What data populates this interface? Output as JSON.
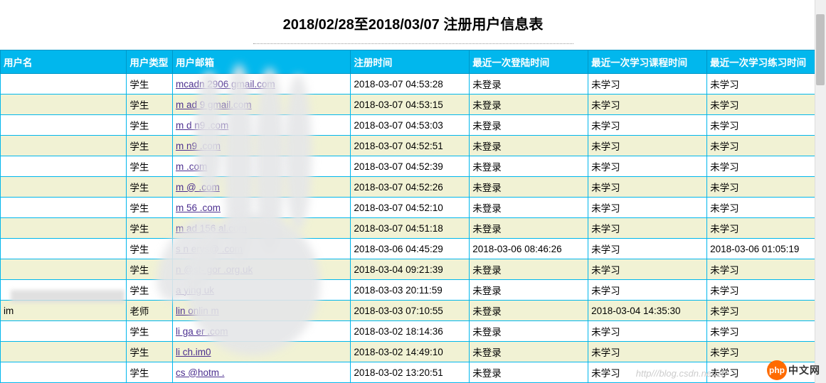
{
  "title": "2018/02/28至2018/03/07 注册用户信息表",
  "columns": {
    "username": "用户名",
    "type": "用户类型",
    "email": "用户邮箱",
    "regtime": "注册时间",
    "lastlogin": "最近一次登陆时间",
    "laststudy": "最近一次学习课程时间",
    "lastpractice": "最近一次学习练习时间"
  },
  "rows": [
    {
      "username": "",
      "type": "学生",
      "email": "mcadn    2906   gmail.com",
      "regtime": "2018-03-07 04:53:28",
      "lastlogin": "未登录",
      "laststudy": "未学习",
      "lastpractice": "未学习"
    },
    {
      "username": "",
      "type": "学生",
      "email": "m   ad       9     gmail.com",
      "regtime": "2018-03-07 04:53:15",
      "lastlogin": "未登录",
      "laststudy": "未学习",
      "lastpractice": "未学习"
    },
    {
      "username": "",
      "type": "学生",
      "email": "m   d    n9          .com",
      "regtime": "2018-03-07 04:53:03",
      "lastlogin": "未登录",
      "laststudy": "未学习",
      "lastpractice": "未学习"
    },
    {
      "username": "",
      "type": "学生",
      "email": "m       n9          .com",
      "regtime": "2018-03-07 04:52:51",
      "lastlogin": "未登录",
      "laststudy": "未学习",
      "lastpractice": "未学习"
    },
    {
      "username": "",
      "type": "学生",
      "email": "m                   .com",
      "regtime": "2018-03-07 04:52:39",
      "lastlogin": "未登录",
      "laststudy": "未学习",
      "lastpractice": "未学习"
    },
    {
      "username": "",
      "type": "学生",
      "email": "m              @    .com",
      "regtime": "2018-03-07 04:52:26",
      "lastlogin": "未登录",
      "laststudy": "未学习",
      "lastpractice": "未学习"
    },
    {
      "username": "",
      "type": "学生",
      "email": "m          56      .com",
      "regtime": "2018-03-07 04:52:10",
      "lastlogin": "未登录",
      "laststudy": "未学习",
      "lastpractice": "未学习"
    },
    {
      "username": "",
      "type": "学生",
      "email": "m   ad    156     al.com",
      "regtime": "2018-03-07 04:51:18",
      "lastlogin": "未登录",
      "laststudy": "未学习",
      "lastpractice": "未学习"
    },
    {
      "username": "",
      "type": "学生",
      "email": "s    n    erys@      .com",
      "regtime": "2018-03-06 04:45:29",
      "lastlogin": "2018-03-06 08:46:26",
      "laststudy": "未学习",
      "lastpractice": "2018-03-06 01:05:19"
    },
    {
      "username": "",
      "type": "学生",
      "email": "    n    @st-   gor   .org.uk",
      "regtime": "2018-03-04 09:21:39",
      "lastlogin": "未登录",
      "laststudy": "未学习",
      "lastpractice": "未学习"
    },
    {
      "username": "",
      "type": "学生",
      "email": "a       ying        uk",
      "regtime": "2018-03-03 20:11:59",
      "lastlogin": "未登录",
      "laststudy": "未学习",
      "lastpractice": "未学习"
    },
    {
      "username": "              im",
      "type": "老师",
      "email": "lin        onlin      m",
      "regtime": "2018-03-03 07:10:55",
      "lastlogin": "未登录",
      "laststudy": "2018-03-04 14:35:30",
      "lastpractice": "未学习"
    },
    {
      "username": "",
      "type": "学生",
      "email": "li     ga   er     .com",
      "regtime": "2018-03-02 18:14:36",
      "lastlogin": "未登录",
      "laststudy": "未学习",
      "lastpractice": "未学习"
    },
    {
      "username": "",
      "type": "学生",
      "email": "li        ch.im0",
      "regtime": "2018-03-02 14:49:10",
      "lastlogin": "未登录",
      "laststudy": "未学习",
      "lastpractice": "未学习"
    },
    {
      "username": "",
      "type": "学生",
      "email": "cs     @hotm     .",
      "regtime": "2018-03-02 13:20:51",
      "lastlogin": "未登录",
      "laststudy": "未学习",
      "lastpractice": "未学习"
    }
  ],
  "watermark": "http///blog.csdn.net/zh",
  "badge": {
    "circle": "php",
    "text": "中文网"
  }
}
